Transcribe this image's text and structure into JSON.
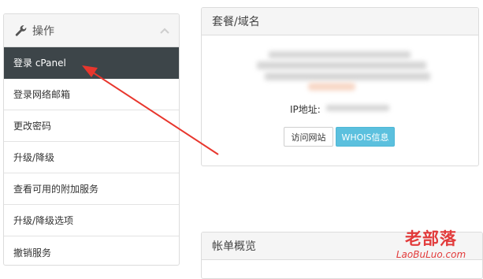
{
  "sidebar": {
    "title": "操作",
    "items": [
      {
        "label": "登录 cPanel",
        "active": true
      },
      {
        "label": "登录网络邮箱"
      },
      {
        "label": "更改密码"
      },
      {
        "label": "升级/降级"
      },
      {
        "label": "查看可用的附加服务"
      },
      {
        "label": "升级/降级选项"
      },
      {
        "label": "撤销服务"
      }
    ]
  },
  "package_panel": {
    "title": "套餐/域名",
    "ip_label": "IP地址:",
    "visit_button": "访问网站",
    "whois_button": "WHOIS信息"
  },
  "billing_panel": {
    "title": "帐单概览"
  },
  "watermark": {
    "title": "老部落",
    "url": "LaoBuLuo.com"
  },
  "colors": {
    "active_item_bg": "#3d4549",
    "whois_button": "#5bc0de",
    "arrow": "#e8362d",
    "watermark": "#e23b3b"
  },
  "icons": [
    "wrench-icon",
    "chevron-up-icon",
    "red-arrow-annotation"
  ]
}
